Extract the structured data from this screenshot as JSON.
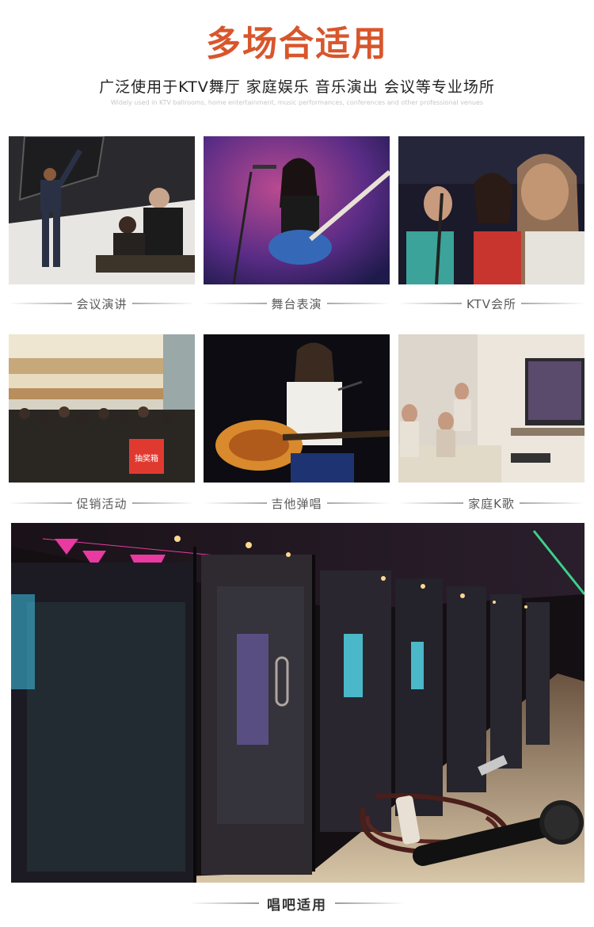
{
  "header": {
    "title": "多场合适用",
    "subtitle": "广泛使用于KTV舞厅 家庭娱乐 音乐演出 会议等专业场所",
    "subtitle_en": "Widely used in KTV ballrooms, home entertainment, music performances, conferences and other professional venues"
  },
  "scenes": [
    {
      "label": "会议演讲"
    },
    {
      "label": "舞台表演"
    },
    {
      "label": "KTV会所"
    },
    {
      "label": "促销活动"
    },
    {
      "label": "吉他弹唱"
    },
    {
      "label": "家庭K歌"
    }
  ],
  "promo_sign": "抽奖箱",
  "feature": {
    "label": "唱吧适用"
  },
  "colors": {
    "title": "#d8562c",
    "caption": "#5a5a5a",
    "rule": "#a8a8a8"
  }
}
